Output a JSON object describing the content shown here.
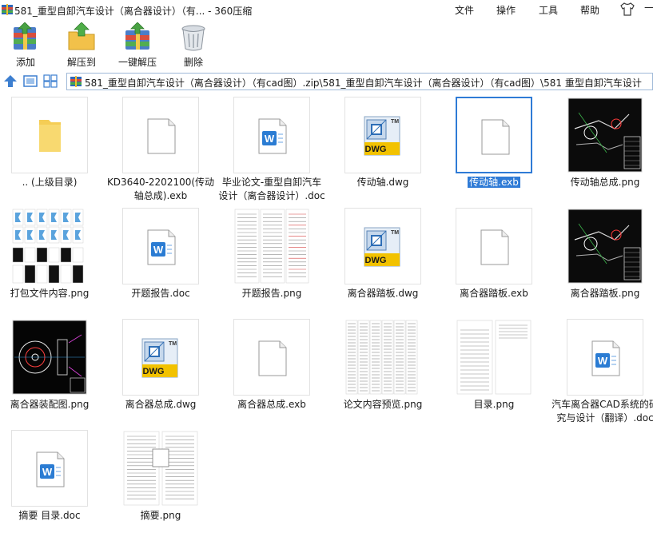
{
  "window": {
    "title": "581_重型自卸汽车设计（离合器设计）（有... - 360压缩"
  },
  "menu": {
    "file": "文件",
    "ops": "操作",
    "tools": "工具",
    "help": "帮助"
  },
  "toolbar": {
    "add": "添加",
    "extract_to": "解压到",
    "one_click": "一键解压",
    "delete": "删除"
  },
  "address": {
    "path": "581_重型自卸汽车设计（离合器设计）（有cad图）.zip\\581_重型自卸汽车设计（离合器设计）（有cad图）\\581 重型自卸汽车设计"
  },
  "files": [
    {
      "name": ".. (上级目录)",
      "type": "folder"
    },
    {
      "name": "KD3640-2202100(传动\n轴总成).exb",
      "type": "blank"
    },
    {
      "name": "毕业论文-重型自卸汽车\n设计（离合器设计）.doc",
      "type": "doc"
    },
    {
      "name": "传动轴.dwg",
      "type": "dwg"
    },
    {
      "name": "传动轴.exb",
      "type": "blank",
      "selected": true
    },
    {
      "name": "传动轴总成.png",
      "type": "cad-dark"
    },
    {
      "name": "打包文件内容.png",
      "type": "pack"
    },
    {
      "name": "开题报告.doc",
      "type": "doc"
    },
    {
      "name": "开题报告.png",
      "type": "report"
    },
    {
      "name": "离合器踏板.dwg",
      "type": "dwg"
    },
    {
      "name": "离合器踏板.exb",
      "type": "blank"
    },
    {
      "name": "离合器踏板.png",
      "type": "cad-dark"
    },
    {
      "name": "离合器装配图.png",
      "type": "cad-assembly"
    },
    {
      "name": "离合器总成.dwg",
      "type": "dwg"
    },
    {
      "name": "离合器总成.exb",
      "type": "blank"
    },
    {
      "name": "论文内容预览.png",
      "type": "paper"
    },
    {
      "name": "目录.png",
      "type": "toc"
    },
    {
      "name": "汽车离合器CAD系统的研\n究与设计（翻译）.doc",
      "type": "doc"
    },
    {
      "name": "摘要  目录.doc",
      "type": "doc"
    },
    {
      "name": "摘要.png",
      "type": "abstract"
    }
  ],
  "icons": {
    "dwg_label": "DWG",
    "tm": "TM",
    "word": "W"
  },
  "colors": {
    "selection": "#2f7bd6",
    "folder": "#f5cd55",
    "word": "#2b7cd3",
    "dwg_yellow": "#f2c200"
  }
}
